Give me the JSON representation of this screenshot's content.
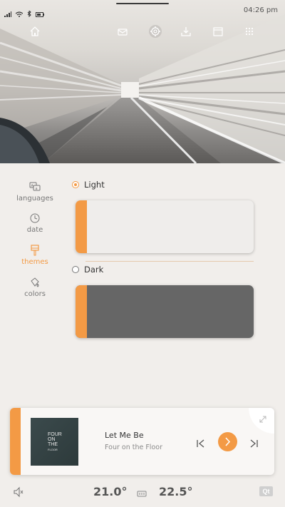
{
  "status": {
    "time": "04:26 pm"
  },
  "nav": [
    "home-icon",
    "mail-icon",
    "gear-icon",
    "download-icon",
    "calendar-icon",
    "apps-icon"
  ],
  "menu": {
    "items": [
      {
        "id": "languages",
        "label": "languages",
        "icon": "languages-icon"
      },
      {
        "id": "date",
        "label": "date",
        "icon": "clock-icon"
      },
      {
        "id": "themes",
        "label": "themes",
        "icon": "brush-icon",
        "active": true
      },
      {
        "id": "colors",
        "label": "colors",
        "icon": "palette-icon"
      }
    ]
  },
  "themes": {
    "light_label": "Light",
    "dark_label": "Dark",
    "selected": "Light",
    "light_color": "#efedeb",
    "dark_color": "#666666",
    "accent": "#f39a45"
  },
  "player": {
    "song": "Let Me Be",
    "artist": "Four on the Floor",
    "album_art_text": [
      "FOUR",
      "ON",
      "THE",
      "FLOOR"
    ]
  },
  "climate": {
    "left_temp": "21.0°",
    "right_temp": "22.5°"
  },
  "brand": "Qt"
}
